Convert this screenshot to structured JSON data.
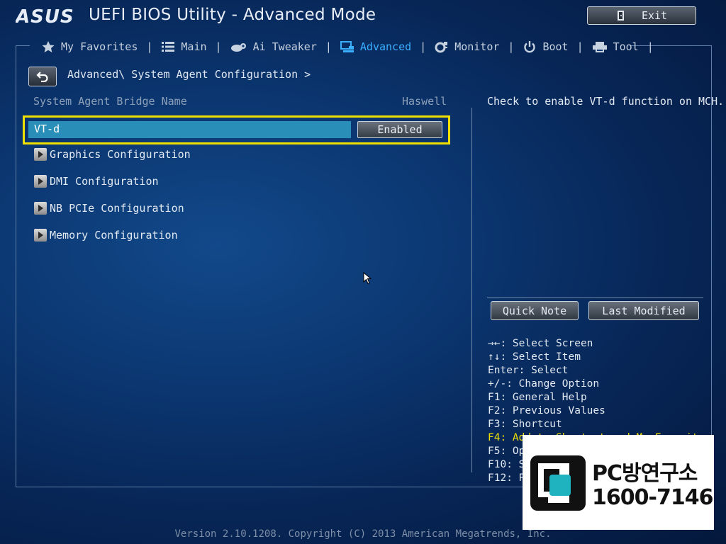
{
  "header": {
    "brand": "ASUS",
    "title": "UEFI BIOS Utility - Advanced Mode",
    "exit_label": "Exit"
  },
  "tabs": [
    {
      "label": "My Favorites",
      "icon": "star-icon"
    },
    {
      "label": "Main",
      "icon": "list-icon"
    },
    {
      "label": "Ai Tweaker",
      "icon": "tweaker-icon"
    },
    {
      "label": "Advanced",
      "icon": "advanced-icon",
      "active": true
    },
    {
      "label": "Monitor",
      "icon": "monitor-gauge-icon"
    },
    {
      "label": "Boot",
      "icon": "power-icon"
    },
    {
      "label": "Tool",
      "icon": "printer-icon"
    }
  ],
  "breadcrumb": "Advanced\\ System Agent Configuration >",
  "settings": {
    "bridge_label": "System Agent Bridge Name",
    "bridge_value": "Haswell",
    "vtd_label": "VT-d",
    "vtd_value": "Enabled",
    "submenus": [
      "Graphics Configuration",
      "DMI Configuration",
      "NB PCIe Configuration",
      "Memory Configuration"
    ]
  },
  "help": {
    "text": "Check to enable VT-d function on MCH.",
    "quick_note": "Quick Note",
    "last_modified": "Last Modified",
    "keys": [
      "→←: Select Screen",
      "↑↓: Select Item",
      "Enter: Select",
      "+/-: Change Option",
      "F1: General Help",
      "F2: Previous Values",
      "F3: Shortcut",
      "F4: Add to Shortcut and My Favorite",
      "F5: Optimized Defaults",
      "F10: Save",
      "F12: Print Screen"
    ],
    "highlight_key_index": 7
  },
  "footer": {
    "version": "Version 2.10.1208. Copyright (C) 2013 American Megatrends, Inc."
  },
  "watermark": {
    "name": "PC방연구소",
    "phone": "1600-7146"
  },
  "colors": {
    "accent": "#3ab0ff",
    "highlight_border": "#f0e000",
    "selected_row": "#2a8fb8"
  }
}
